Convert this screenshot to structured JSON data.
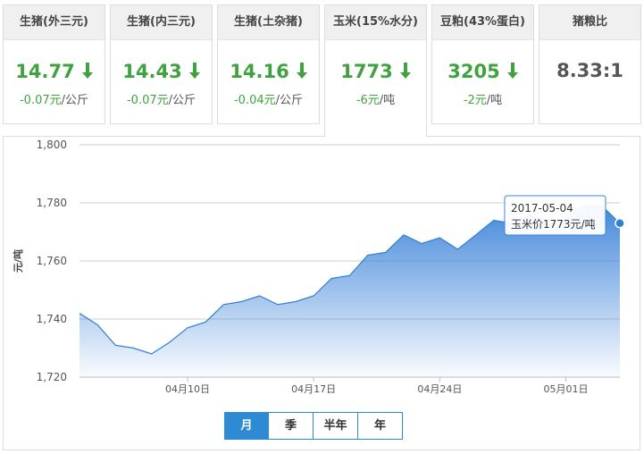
{
  "cards": [
    {
      "title": "生猪(外三元)",
      "price": "14.77",
      "change": "-0.07元",
      "unit": "/公斤"
    },
    {
      "title": "生猪(内三元)",
      "price": "14.43",
      "change": "-0.07元",
      "unit": "/公斤"
    },
    {
      "title": "生猪(土杂猪)",
      "price": "14.16",
      "change": "-0.04元",
      "unit": "/公斤"
    },
    {
      "title": "玉米(15%水分)",
      "price": "1773",
      "change": "-6元",
      "unit": "/吨"
    },
    {
      "title": "豆粕(43%蛋白)",
      "price": "3205",
      "change": "-2元",
      "unit": "/吨"
    }
  ],
  "ratio_card": {
    "title": "猪粮比",
    "value": "8.33:1"
  },
  "colors": {
    "down": "#3ea33e",
    "accent": "#2f8ad4",
    "area_top": "#3b82d9",
    "line": "#2f7fd2"
  },
  "icons": {
    "down": "down-arrow-icon"
  },
  "tabs": [
    {
      "label": "月",
      "active": true
    },
    {
      "label": "季",
      "active": false
    },
    {
      "label": "半年",
      "active": false
    },
    {
      "label": "年",
      "active": false
    }
  ],
  "chart_data": {
    "type": "area",
    "ylabel": "元/吨",
    "ylim": [
      1720,
      1800
    ],
    "yticks": [
      "1,720",
      "1,740",
      "1,760",
      "1,780",
      "1,800"
    ],
    "ytick_values": [
      1720,
      1740,
      1760,
      1780,
      1800
    ],
    "grid": true,
    "xtick_labels": [
      "04月10日",
      "04月17日",
      "04月24日",
      "05月01日"
    ],
    "xtick_dates": [
      "2017-04-10",
      "2017-04-17",
      "2017-04-24",
      "2017-05-01"
    ],
    "series": [
      {
        "x": [
          "2017-04-04",
          "2017-04-05",
          "2017-04-06",
          "2017-04-07",
          "2017-04-08",
          "2017-04-09",
          "2017-04-10",
          "2017-04-11",
          "2017-04-12",
          "2017-04-13",
          "2017-04-14",
          "2017-04-15",
          "2017-04-16",
          "2017-04-17",
          "2017-04-18",
          "2017-04-19",
          "2017-04-20",
          "2017-04-21",
          "2017-04-22",
          "2017-04-23",
          "2017-04-24",
          "2017-04-25",
          "2017-04-26",
          "2017-04-27",
          "2017-04-28",
          "2017-04-29",
          "2017-04-30",
          "2017-05-01",
          "2017-05-02",
          "2017-05-03",
          "2017-05-04"
        ],
        "values": [
          1742,
          1738,
          1731,
          1730,
          1728,
          1732,
          1737,
          1739,
          1745,
          1746,
          1748,
          1745,
          1746,
          1748,
          1754,
          1755,
          1762,
          1763,
          1769,
          1766,
          1768,
          1764,
          1769,
          1774,
          1773,
          1776,
          1773,
          1775,
          1779,
          1779,
          1773
        ]
      }
    ],
    "tooltip": {
      "date": "2017-05-04",
      "label": "玉米价1773元/吨"
    }
  }
}
